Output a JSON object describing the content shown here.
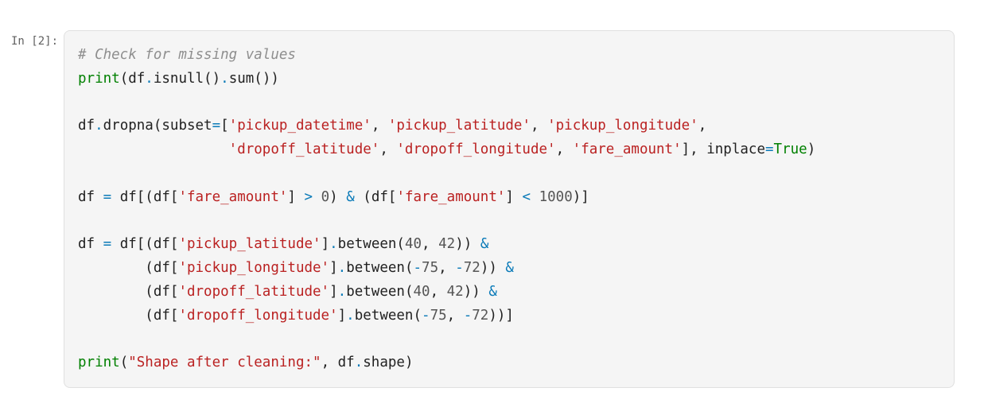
{
  "prompt": "In [2]:",
  "colors": {
    "cell_background": "#f5f5f5",
    "cell_border": "#e0e0e0",
    "comment": "#8e8e8e",
    "builtin": "#008000",
    "keyword": "#008000",
    "string": "#ba2121",
    "operator": "#0a7ab8",
    "number": "#555555",
    "text": "#212121"
  },
  "code_lines": [
    [
      {
        "text": "# Check for missing values",
        "kind": "comment"
      }
    ],
    [
      {
        "text": "print",
        "kind": "builtin"
      },
      {
        "text": "(df",
        "kind": "punct"
      },
      {
        "text": ".",
        "kind": "op"
      },
      {
        "text": "isnull()",
        "kind": "name"
      },
      {
        "text": ".",
        "kind": "op"
      },
      {
        "text": "sum())",
        "kind": "name"
      }
    ],
    [],
    [
      {
        "text": "df",
        "kind": "name"
      },
      {
        "text": ".",
        "kind": "op"
      },
      {
        "text": "dropna(subset",
        "kind": "name"
      },
      {
        "text": "=",
        "kind": "op"
      },
      {
        "text": "[",
        "kind": "punct"
      },
      {
        "text": "'pickup_datetime'",
        "kind": "string"
      },
      {
        "text": ", ",
        "kind": "punct"
      },
      {
        "text": "'pickup_latitude'",
        "kind": "string"
      },
      {
        "text": ", ",
        "kind": "punct"
      },
      {
        "text": "'pickup_longitude'",
        "kind": "string"
      },
      {
        "text": ",",
        "kind": "punct"
      }
    ],
    [
      {
        "text": "                  ",
        "kind": "punct"
      },
      {
        "text": "'dropoff_latitude'",
        "kind": "string"
      },
      {
        "text": ", ",
        "kind": "punct"
      },
      {
        "text": "'dropoff_longitude'",
        "kind": "string"
      },
      {
        "text": ", ",
        "kind": "punct"
      },
      {
        "text": "'fare_amount'",
        "kind": "string"
      },
      {
        "text": "], inplace",
        "kind": "punct"
      },
      {
        "text": "=",
        "kind": "op"
      },
      {
        "text": "True",
        "kind": "keyword"
      },
      {
        "text": ")",
        "kind": "punct"
      }
    ],
    [],
    [
      {
        "text": "df ",
        "kind": "name"
      },
      {
        "text": "=",
        "kind": "op"
      },
      {
        "text": " df[(df[",
        "kind": "punct"
      },
      {
        "text": "'fare_amount'",
        "kind": "string"
      },
      {
        "text": "] ",
        "kind": "punct"
      },
      {
        "text": ">",
        "kind": "op"
      },
      {
        "text": " ",
        "kind": "punct"
      },
      {
        "text": "0",
        "kind": "number"
      },
      {
        "text": ") ",
        "kind": "punct"
      },
      {
        "text": "&",
        "kind": "op"
      },
      {
        "text": " (df[",
        "kind": "punct"
      },
      {
        "text": "'fare_amount'",
        "kind": "string"
      },
      {
        "text": "] ",
        "kind": "punct"
      },
      {
        "text": "<",
        "kind": "op"
      },
      {
        "text": " ",
        "kind": "punct"
      },
      {
        "text": "1000",
        "kind": "number"
      },
      {
        "text": ")]",
        "kind": "punct"
      }
    ],
    [],
    [
      {
        "text": "df ",
        "kind": "name"
      },
      {
        "text": "=",
        "kind": "op"
      },
      {
        "text": " df[(df[",
        "kind": "punct"
      },
      {
        "text": "'pickup_latitude'",
        "kind": "string"
      },
      {
        "text": "]",
        "kind": "punct"
      },
      {
        "text": ".",
        "kind": "op"
      },
      {
        "text": "between(",
        "kind": "name"
      },
      {
        "text": "40",
        "kind": "number"
      },
      {
        "text": ", ",
        "kind": "punct"
      },
      {
        "text": "42",
        "kind": "number"
      },
      {
        "text": ")) ",
        "kind": "punct"
      },
      {
        "text": "&",
        "kind": "op"
      }
    ],
    [
      {
        "text": "        (df[",
        "kind": "punct"
      },
      {
        "text": "'pickup_longitude'",
        "kind": "string"
      },
      {
        "text": "]",
        "kind": "punct"
      },
      {
        "text": ".",
        "kind": "op"
      },
      {
        "text": "between(",
        "kind": "name"
      },
      {
        "text": "-",
        "kind": "op"
      },
      {
        "text": "75",
        "kind": "number"
      },
      {
        "text": ", ",
        "kind": "punct"
      },
      {
        "text": "-",
        "kind": "op"
      },
      {
        "text": "72",
        "kind": "number"
      },
      {
        "text": ")) ",
        "kind": "punct"
      },
      {
        "text": "&",
        "kind": "op"
      }
    ],
    [
      {
        "text": "        (df[",
        "kind": "punct"
      },
      {
        "text": "'dropoff_latitude'",
        "kind": "string"
      },
      {
        "text": "]",
        "kind": "punct"
      },
      {
        "text": ".",
        "kind": "op"
      },
      {
        "text": "between(",
        "kind": "name"
      },
      {
        "text": "40",
        "kind": "number"
      },
      {
        "text": ", ",
        "kind": "punct"
      },
      {
        "text": "42",
        "kind": "number"
      },
      {
        "text": ")) ",
        "kind": "punct"
      },
      {
        "text": "&",
        "kind": "op"
      }
    ],
    [
      {
        "text": "        (df[",
        "kind": "punct"
      },
      {
        "text": "'dropoff_longitude'",
        "kind": "string"
      },
      {
        "text": "]",
        "kind": "punct"
      },
      {
        "text": ".",
        "kind": "op"
      },
      {
        "text": "between(",
        "kind": "name"
      },
      {
        "text": "-",
        "kind": "op"
      },
      {
        "text": "75",
        "kind": "number"
      },
      {
        "text": ", ",
        "kind": "punct"
      },
      {
        "text": "-",
        "kind": "op"
      },
      {
        "text": "72",
        "kind": "number"
      },
      {
        "text": "))]",
        "kind": "punct"
      }
    ],
    [],
    [
      {
        "text": "print",
        "kind": "builtin"
      },
      {
        "text": "(",
        "kind": "punct"
      },
      {
        "text": "\"Shape after cleaning:\"",
        "kind": "string"
      },
      {
        "text": ", df",
        "kind": "punct"
      },
      {
        "text": ".",
        "kind": "op"
      },
      {
        "text": "shape)",
        "kind": "name"
      }
    ]
  ]
}
